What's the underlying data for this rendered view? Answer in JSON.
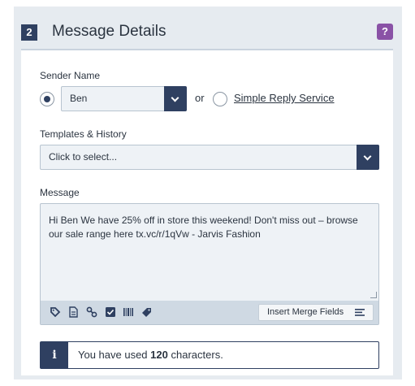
{
  "header": {
    "step": "2",
    "title": "Message Details",
    "help": "?"
  },
  "sender": {
    "label": "Sender Name",
    "selected": "Ben",
    "or": "or",
    "alt_option": "Simple Reply Service"
  },
  "templates": {
    "label": "Templates & History",
    "placeholder": "Click to select..."
  },
  "message": {
    "label": "Message",
    "text": "Hi Ben We have 25% off in store this weekend! Don't miss out – browse our sale range here tx.vc/r/1qVw - Jarvis Fashion",
    "toolbar_icons": [
      "tag-icon",
      "document-icon",
      "link-icon",
      "checkbox-icon",
      "barcode-icon",
      "ticket-icon"
    ],
    "merge_button": "Insert Merge Fields"
  },
  "info": {
    "icon": "i",
    "prefix": "You have used",
    "count": "120",
    "suffix": "characters."
  },
  "colors": {
    "accent": "#2f4061",
    "help": "#8a52a6",
    "panel": "#e6ebf0"
  }
}
